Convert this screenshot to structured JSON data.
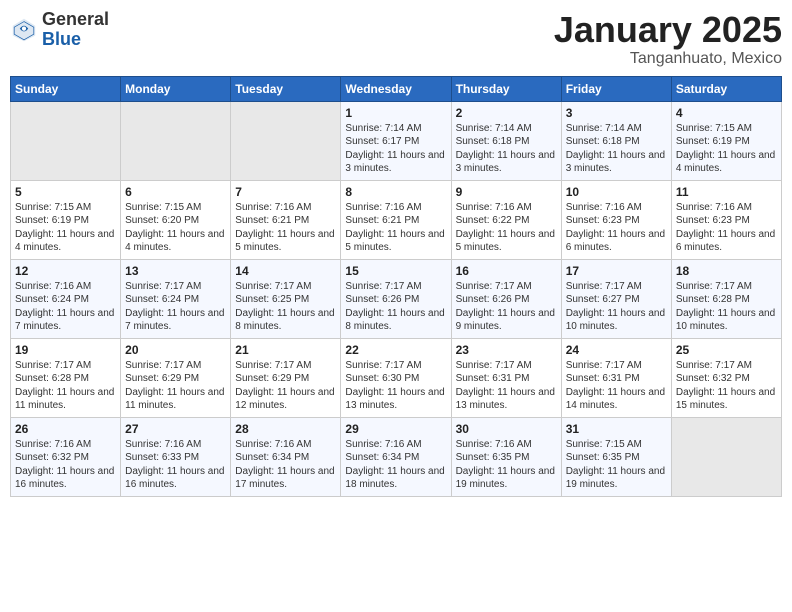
{
  "header": {
    "logo_general": "General",
    "logo_blue": "Blue",
    "month_year": "January 2025",
    "location": "Tanganhuato, Mexico"
  },
  "weekdays": [
    "Sunday",
    "Monday",
    "Tuesday",
    "Wednesday",
    "Thursday",
    "Friday",
    "Saturday"
  ],
  "weeks": [
    [
      {
        "day": "",
        "sunrise": "",
        "sunset": "",
        "daylight": ""
      },
      {
        "day": "",
        "sunrise": "",
        "sunset": "",
        "daylight": ""
      },
      {
        "day": "",
        "sunrise": "",
        "sunset": "",
        "daylight": ""
      },
      {
        "day": "1",
        "sunrise": "Sunrise: 7:14 AM",
        "sunset": "Sunset: 6:17 PM",
        "daylight": "Daylight: 11 hours and 3 minutes."
      },
      {
        "day": "2",
        "sunrise": "Sunrise: 7:14 AM",
        "sunset": "Sunset: 6:18 PM",
        "daylight": "Daylight: 11 hours and 3 minutes."
      },
      {
        "day": "3",
        "sunrise": "Sunrise: 7:14 AM",
        "sunset": "Sunset: 6:18 PM",
        "daylight": "Daylight: 11 hours and 3 minutes."
      },
      {
        "day": "4",
        "sunrise": "Sunrise: 7:15 AM",
        "sunset": "Sunset: 6:19 PM",
        "daylight": "Daylight: 11 hours and 4 minutes."
      }
    ],
    [
      {
        "day": "5",
        "sunrise": "Sunrise: 7:15 AM",
        "sunset": "Sunset: 6:19 PM",
        "daylight": "Daylight: 11 hours and 4 minutes."
      },
      {
        "day": "6",
        "sunrise": "Sunrise: 7:15 AM",
        "sunset": "Sunset: 6:20 PM",
        "daylight": "Daylight: 11 hours and 4 minutes."
      },
      {
        "day": "7",
        "sunrise": "Sunrise: 7:16 AM",
        "sunset": "Sunset: 6:21 PM",
        "daylight": "Daylight: 11 hours and 5 minutes."
      },
      {
        "day": "8",
        "sunrise": "Sunrise: 7:16 AM",
        "sunset": "Sunset: 6:21 PM",
        "daylight": "Daylight: 11 hours and 5 minutes."
      },
      {
        "day": "9",
        "sunrise": "Sunrise: 7:16 AM",
        "sunset": "Sunset: 6:22 PM",
        "daylight": "Daylight: 11 hours and 5 minutes."
      },
      {
        "day": "10",
        "sunrise": "Sunrise: 7:16 AM",
        "sunset": "Sunset: 6:23 PM",
        "daylight": "Daylight: 11 hours and 6 minutes."
      },
      {
        "day": "11",
        "sunrise": "Sunrise: 7:16 AM",
        "sunset": "Sunset: 6:23 PM",
        "daylight": "Daylight: 11 hours and 6 minutes."
      }
    ],
    [
      {
        "day": "12",
        "sunrise": "Sunrise: 7:16 AM",
        "sunset": "Sunset: 6:24 PM",
        "daylight": "Daylight: 11 hours and 7 minutes."
      },
      {
        "day": "13",
        "sunrise": "Sunrise: 7:17 AM",
        "sunset": "Sunset: 6:24 PM",
        "daylight": "Daylight: 11 hours and 7 minutes."
      },
      {
        "day": "14",
        "sunrise": "Sunrise: 7:17 AM",
        "sunset": "Sunset: 6:25 PM",
        "daylight": "Daylight: 11 hours and 8 minutes."
      },
      {
        "day": "15",
        "sunrise": "Sunrise: 7:17 AM",
        "sunset": "Sunset: 6:26 PM",
        "daylight": "Daylight: 11 hours and 8 minutes."
      },
      {
        "day": "16",
        "sunrise": "Sunrise: 7:17 AM",
        "sunset": "Sunset: 6:26 PM",
        "daylight": "Daylight: 11 hours and 9 minutes."
      },
      {
        "day": "17",
        "sunrise": "Sunrise: 7:17 AM",
        "sunset": "Sunset: 6:27 PM",
        "daylight": "Daylight: 11 hours and 10 minutes."
      },
      {
        "day": "18",
        "sunrise": "Sunrise: 7:17 AM",
        "sunset": "Sunset: 6:28 PM",
        "daylight": "Daylight: 11 hours and 10 minutes."
      }
    ],
    [
      {
        "day": "19",
        "sunrise": "Sunrise: 7:17 AM",
        "sunset": "Sunset: 6:28 PM",
        "daylight": "Daylight: 11 hours and 11 minutes."
      },
      {
        "day": "20",
        "sunrise": "Sunrise: 7:17 AM",
        "sunset": "Sunset: 6:29 PM",
        "daylight": "Daylight: 11 hours and 11 minutes."
      },
      {
        "day": "21",
        "sunrise": "Sunrise: 7:17 AM",
        "sunset": "Sunset: 6:29 PM",
        "daylight": "Daylight: 11 hours and 12 minutes."
      },
      {
        "day": "22",
        "sunrise": "Sunrise: 7:17 AM",
        "sunset": "Sunset: 6:30 PM",
        "daylight": "Daylight: 11 hours and 13 minutes."
      },
      {
        "day": "23",
        "sunrise": "Sunrise: 7:17 AM",
        "sunset": "Sunset: 6:31 PM",
        "daylight": "Daylight: 11 hours and 13 minutes."
      },
      {
        "day": "24",
        "sunrise": "Sunrise: 7:17 AM",
        "sunset": "Sunset: 6:31 PM",
        "daylight": "Daylight: 11 hours and 14 minutes."
      },
      {
        "day": "25",
        "sunrise": "Sunrise: 7:17 AM",
        "sunset": "Sunset: 6:32 PM",
        "daylight": "Daylight: 11 hours and 15 minutes."
      }
    ],
    [
      {
        "day": "26",
        "sunrise": "Sunrise: 7:16 AM",
        "sunset": "Sunset: 6:32 PM",
        "daylight": "Daylight: 11 hours and 16 minutes."
      },
      {
        "day": "27",
        "sunrise": "Sunrise: 7:16 AM",
        "sunset": "Sunset: 6:33 PM",
        "daylight": "Daylight: 11 hours and 16 minutes."
      },
      {
        "day": "28",
        "sunrise": "Sunrise: 7:16 AM",
        "sunset": "Sunset: 6:34 PM",
        "daylight": "Daylight: 11 hours and 17 minutes."
      },
      {
        "day": "29",
        "sunrise": "Sunrise: 7:16 AM",
        "sunset": "Sunset: 6:34 PM",
        "daylight": "Daylight: 11 hours and 18 minutes."
      },
      {
        "day": "30",
        "sunrise": "Sunrise: 7:16 AM",
        "sunset": "Sunset: 6:35 PM",
        "daylight": "Daylight: 11 hours and 19 minutes."
      },
      {
        "day": "31",
        "sunrise": "Sunrise: 7:15 AM",
        "sunset": "Sunset: 6:35 PM",
        "daylight": "Daylight: 11 hours and 19 minutes."
      },
      {
        "day": "",
        "sunrise": "",
        "sunset": "",
        "daylight": ""
      }
    ]
  ]
}
